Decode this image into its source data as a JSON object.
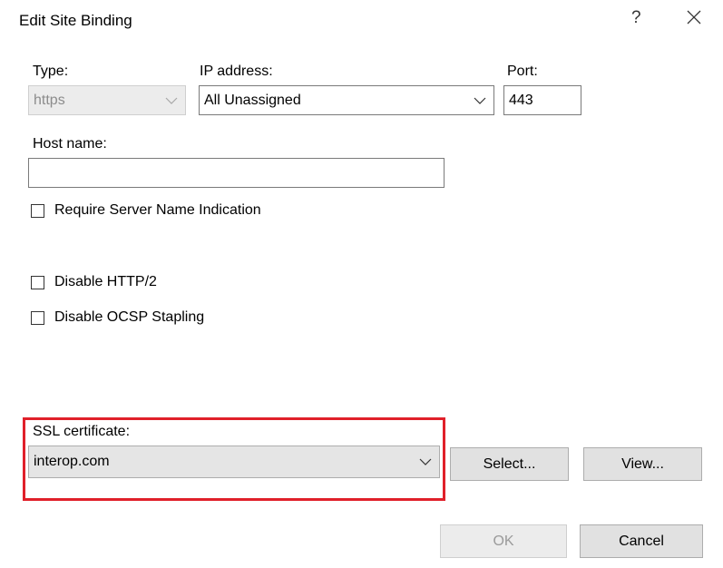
{
  "dialog": {
    "title": "Edit Site Binding",
    "help_label": "?"
  },
  "binding": {
    "type_label": "Type:",
    "type_value": "https",
    "ip_label": "IP address:",
    "ip_value": "All Unassigned",
    "port_label": "Port:",
    "port_value": "443",
    "host_label": "Host name:",
    "host_value": ""
  },
  "options": {
    "sni_label": "Require Server Name Indication",
    "sni_checked": false,
    "http2_label": "Disable HTTP/2",
    "http2_checked": false,
    "ocsp_label": "Disable OCSP Stapling",
    "ocsp_checked": false
  },
  "ssl": {
    "label": "SSL certificate:",
    "value": "interop.com",
    "select_button": "Select...",
    "view_button": "View..."
  },
  "footer": {
    "ok_button": "OK",
    "cancel_button": "Cancel"
  },
  "colors": {
    "highlight": "#e0202a"
  }
}
